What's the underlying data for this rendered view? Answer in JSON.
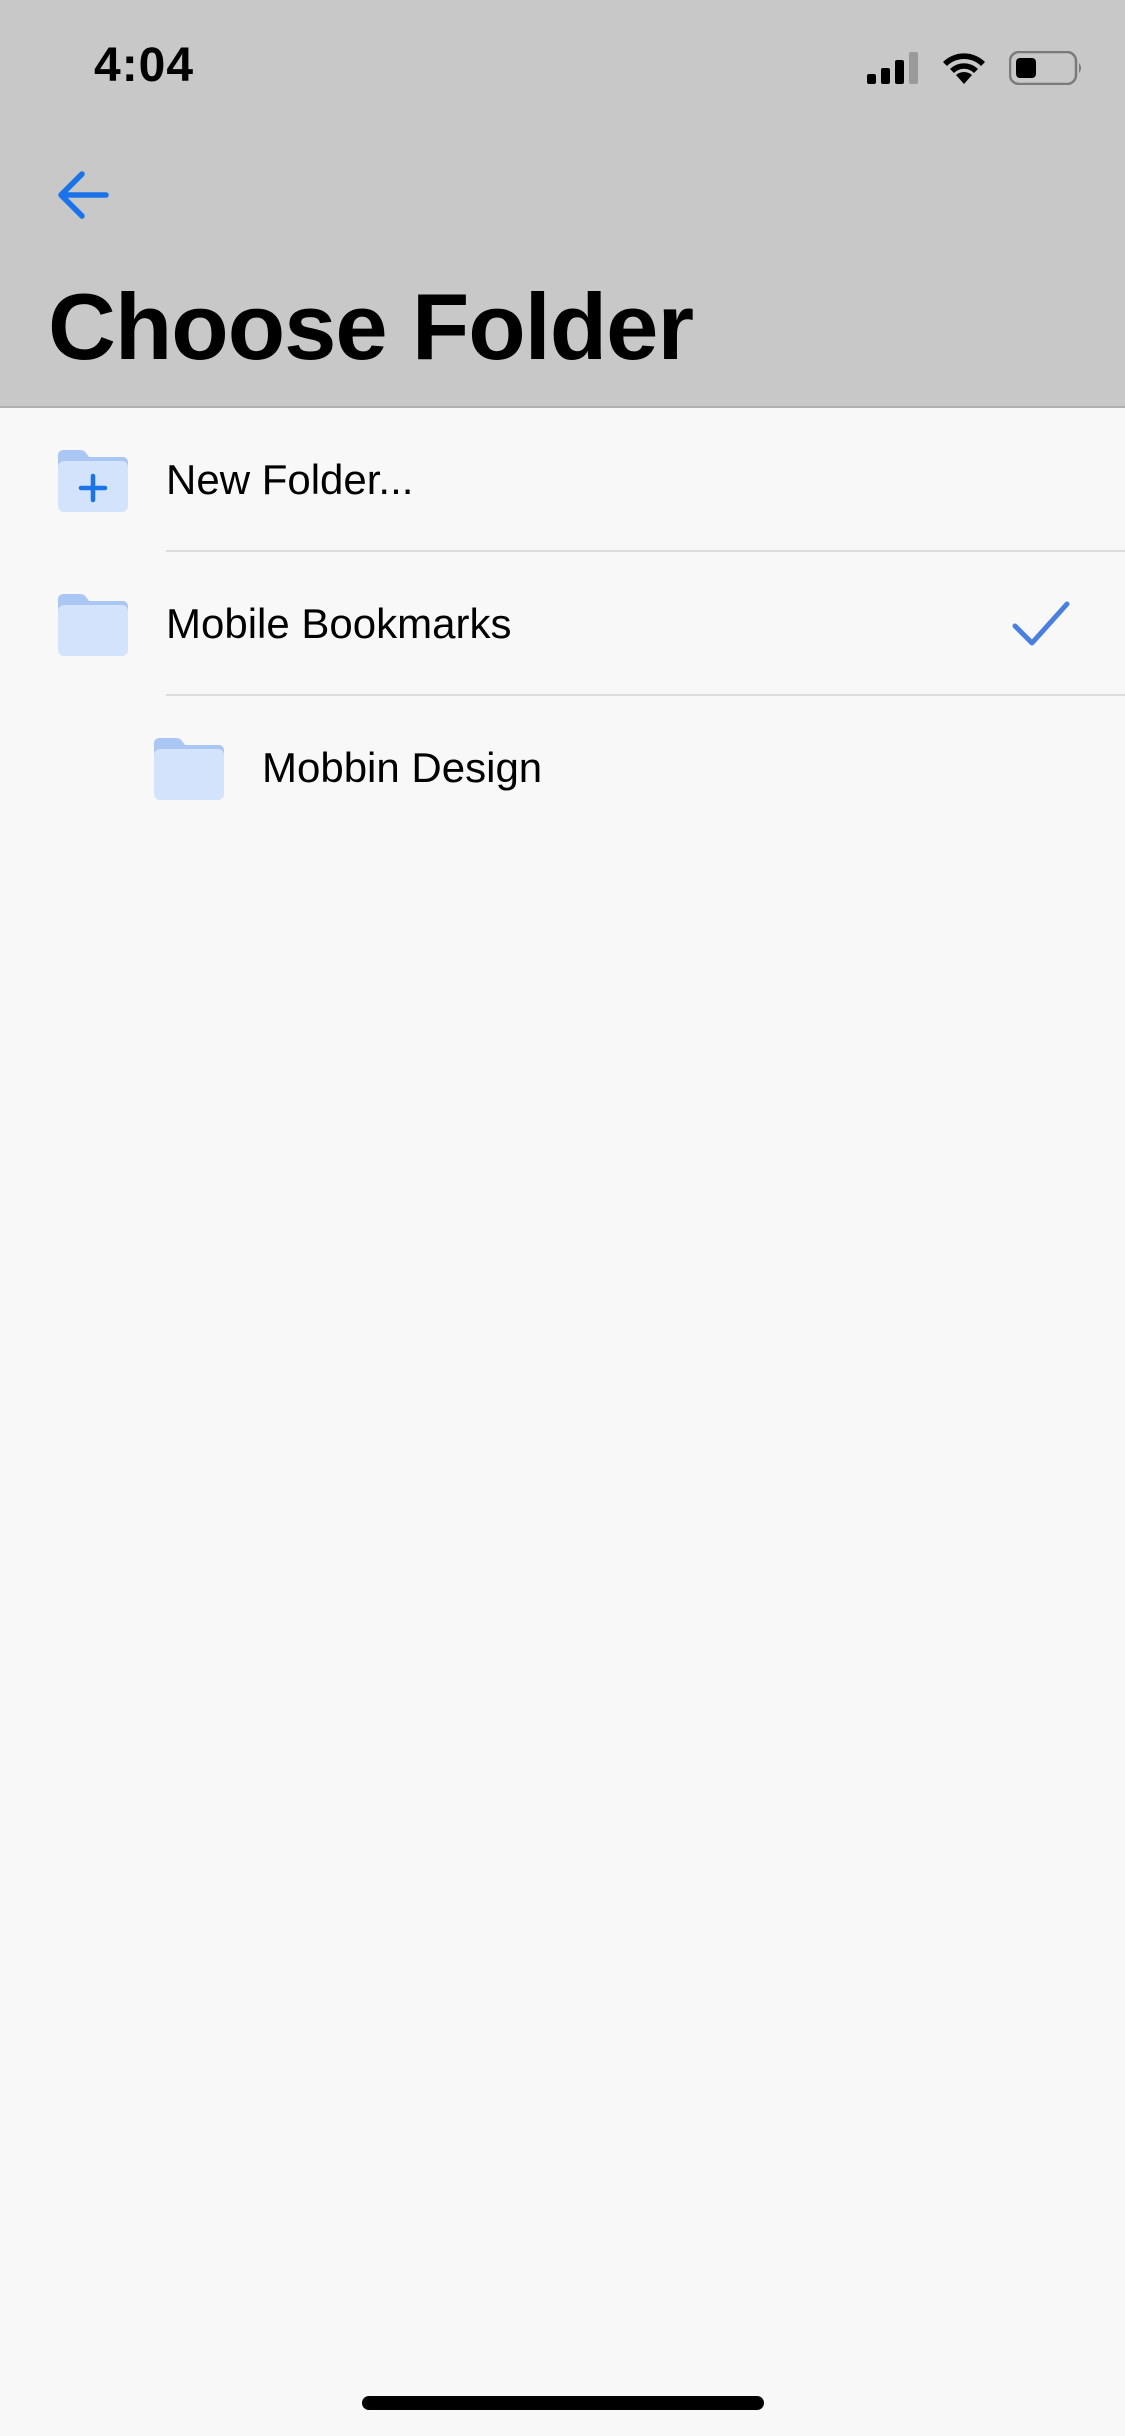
{
  "status_bar": {
    "time": "4:04"
  },
  "header": {
    "title": "Choose Folder"
  },
  "folders": {
    "items": [
      {
        "label": "New Folder...",
        "icon": "folder-plus-icon",
        "selected": false
      },
      {
        "label": "Mobile Bookmarks",
        "icon": "folder-icon",
        "selected": true
      },
      {
        "label": "Mobbin Design",
        "icon": "folder-icon",
        "selected": false
      }
    ]
  },
  "colors": {
    "accent": "#1a73e8",
    "check": "#4a7fe0",
    "folder_fill": "#d3e3fb",
    "folder_tab": "#a9c6f5",
    "header_bg": "#c8c8c8",
    "page_bg": "#f8f8f9"
  }
}
